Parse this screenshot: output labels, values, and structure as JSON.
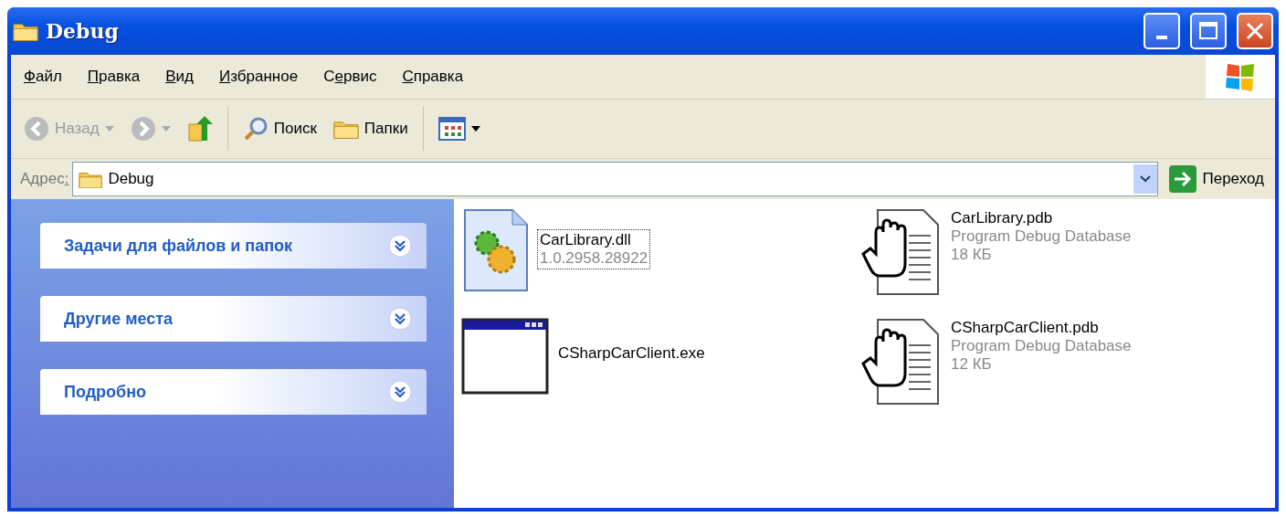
{
  "window": {
    "title": "Debug"
  },
  "menu": [
    {
      "accel": "Ф",
      "after": "айл"
    },
    {
      "accel": "П",
      "after": "равка"
    },
    {
      "accel": "В",
      "after": "ид"
    },
    {
      "accel": "И",
      "after": "збранное"
    },
    {
      "before": "С",
      "accel": "е",
      "after": "рвис"
    },
    {
      "accel": "С",
      "after": "правка"
    }
  ],
  "toolbar": {
    "back": {
      "label": "Назад",
      "disabled": true
    },
    "forward": {
      "disabled": true
    },
    "search": "Поиск",
    "folders": "Папки"
  },
  "address": {
    "label": {
      "before": "Адрес",
      "accel": ":"
    },
    "value": "Debug",
    "go": "Переход"
  },
  "tasks": [
    {
      "title": "Задачи для файлов и папок",
      "expanded": false
    },
    {
      "title": "Другие места",
      "expanded": false
    },
    {
      "title": "Подробно",
      "expanded": false
    }
  ],
  "files": [
    {
      "kind": "dll",
      "name": "CarLibrary.dll",
      "details": [
        "1.0.2958.28922"
      ],
      "focused": true
    },
    {
      "kind": "pdb",
      "name": "CarLibrary.pdb",
      "details": [
        "Program Debug Database",
        "18 КБ"
      ],
      "focused": false
    },
    {
      "kind": "exe",
      "name": "CSharpCarClient.exe",
      "focused": false
    },
    {
      "kind": "pdb",
      "name": "CSharpCarClient.pdb",
      "details": [
        "Program Debug Database",
        "12 КБ"
      ],
      "focused": false
    }
  ]
}
